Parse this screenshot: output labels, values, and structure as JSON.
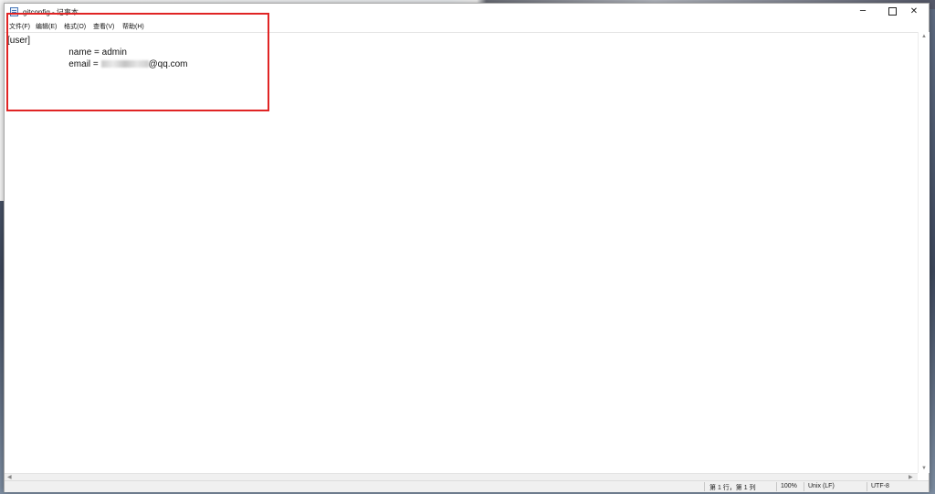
{
  "window": {
    "title": "gitconfig - 记事本",
    "minimize_glyph": "─",
    "close_glyph": "✕"
  },
  "menu": [
    {
      "label": "文件(F)"
    },
    {
      "label": "编辑(E)"
    },
    {
      "label": "格式(O)"
    },
    {
      "label": "查看(V)"
    },
    {
      "label": "帮助(H)"
    }
  ],
  "editor": {
    "line1": "[user]",
    "line2": "\tname = admin",
    "line3_prefix": "\temail = ",
    "line3_suffix": "@qq.com"
  },
  "statusbar": {
    "position": "第 1 行，第 1 列",
    "zoom": "100%",
    "line_ending": "Unix (LF)",
    "encoding": "UTF-8"
  },
  "icons": {
    "app": "notepad-icon",
    "minimize": "minimize-icon",
    "maximize": "maximize-icon",
    "close": "close-icon"
  },
  "colors": {
    "highlight_border": "#e02424",
    "window_bg": "#ffffff",
    "statusbar_bg": "#f0f0f0"
  }
}
